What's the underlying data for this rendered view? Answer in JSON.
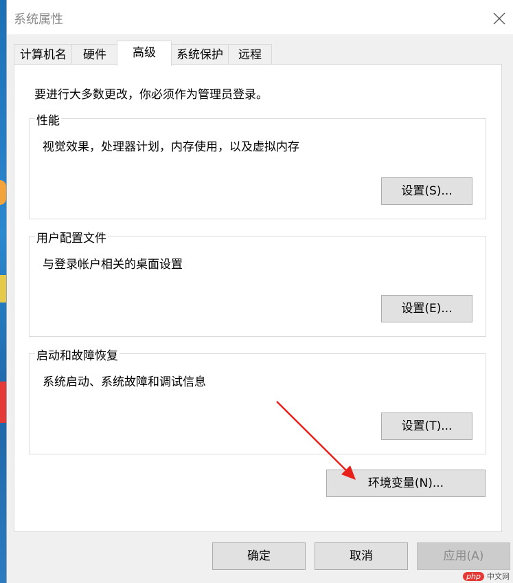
{
  "window": {
    "title": "系统属性"
  },
  "tabs": [
    {
      "label": "计算机名"
    },
    {
      "label": "硬件"
    },
    {
      "label": "高级",
      "active": true
    },
    {
      "label": "系统保护"
    },
    {
      "label": "远程"
    }
  ],
  "advanced": {
    "intro": "要进行大多数更改，你必须作为管理员登录。",
    "performance": {
      "title": "性能",
      "desc": "视觉效果，处理器计划，内存使用，以及虚拟内存",
      "button": "设置(S)..."
    },
    "user_profiles": {
      "title": "用户配置文件",
      "desc": "与登录帐户相关的桌面设置",
      "button": "设置(E)..."
    },
    "startup_recovery": {
      "title": "启动和故障恢复",
      "desc": "系统启动、系统故障和调试信息",
      "button": "设置(T)..."
    },
    "env_button": "环境变量(N)..."
  },
  "footer": {
    "ok": "确定",
    "cancel": "取消",
    "apply": "应用(A)",
    "apply_enabled": false
  },
  "watermark": {
    "badge": "php",
    "text": "中文网"
  },
  "annotation": {
    "arrow_color": "#e8201c"
  },
  "icons": {
    "close": "close-icon",
    "annotation": "red-arrow"
  }
}
